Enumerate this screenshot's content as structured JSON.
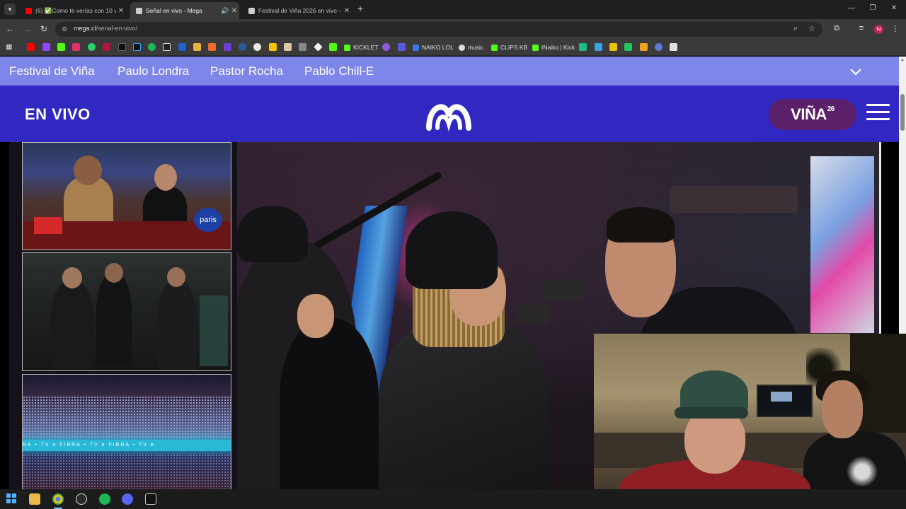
{
  "browser": {
    "tabs": [
      {
        "title": "(6) ✅Como te verías con 10 ve",
        "favicon_color": "#ff0000",
        "active": false
      },
      {
        "title": "Señal en vivo - Mega",
        "favicon_color": "#cfcfcf",
        "active": true,
        "audio": true
      },
      {
        "title": "Festival de Viña 2026 en vivo -",
        "favicon_color": "#cfcfcf",
        "active": false
      }
    ],
    "url_domain": "mega.cl",
    "url_path": "/senal-en-vivo/",
    "profile_initial": "N",
    "bookmarks": [
      {
        "label": "KICKLET",
        "color": "#53fc18"
      },
      {
        "label": "NAIKO LOL",
        "color": "#3a76e8"
      },
      {
        "label": "music",
        "color": "#dddddd"
      },
      {
        "label": "CLIPS KB",
        "color": "#53fc18"
      },
      {
        "label": "INaiko | Kick",
        "color": "#53fc18"
      }
    ]
  },
  "site": {
    "topics": [
      "Festival de Viña",
      "Paulo Londra",
      "Pastor Rocha",
      "Pablo Chill-E"
    ],
    "live_label": "EN VIVO",
    "badge_text": "VIÑA",
    "badge_number": "26",
    "colors": {
      "topics_bar": "#7e86ea",
      "header": "#3128c2",
      "badge": "#5c1f6a"
    }
  },
  "thumbnails": {
    "paris_logo": "paris",
    "ticker_text": "RA • TV   e   FIBRA • TV   e   FIBRA • TV   e"
  },
  "taskbar": {
    "apps": [
      "windows-start",
      "file-explorer",
      "chrome",
      "obs",
      "spotify",
      "discord",
      "capcut"
    ]
  }
}
